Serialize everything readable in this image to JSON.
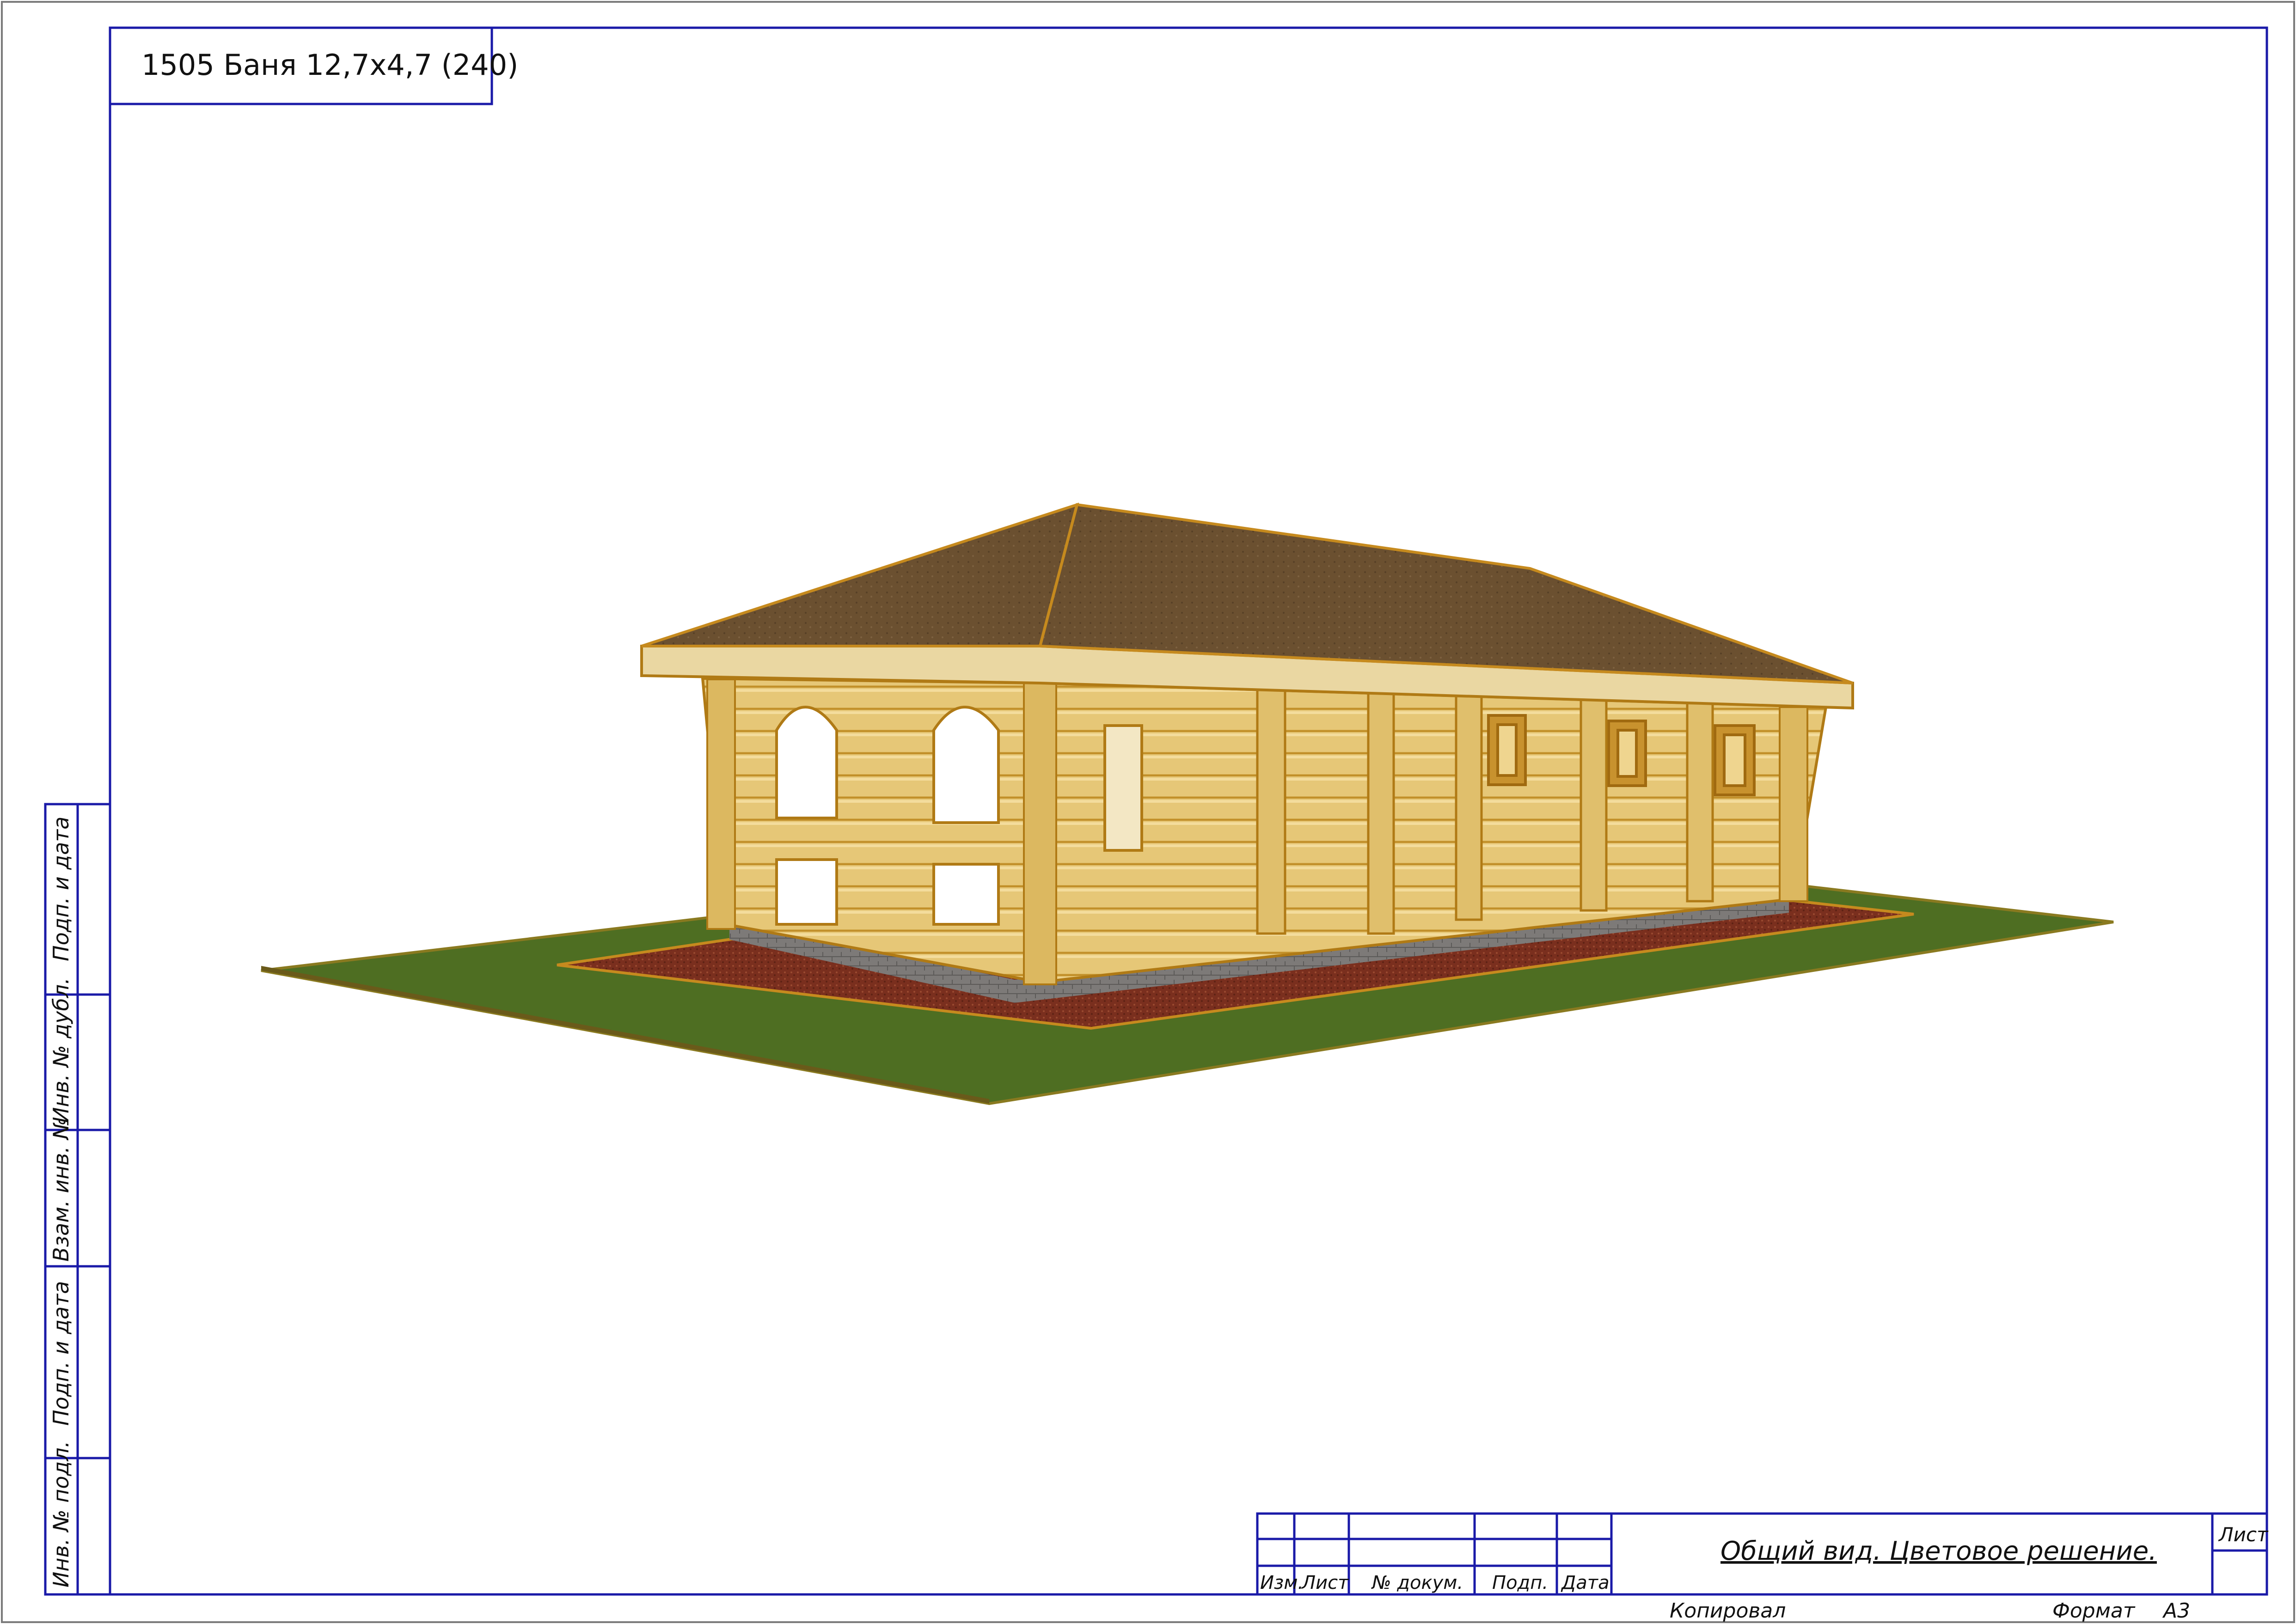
{
  "drawing": {
    "project_label": "1505 Баня 12,7х4,7 (240)",
    "sheet_title": "Общий вид. Цветовое решение.",
    "sheet_label": "Лист",
    "copied_label": "Копировал",
    "format_label": "Формат",
    "format_value": "А3"
  },
  "side_stamp": [
    "Подп. и дата",
    "Инв. № дубл.",
    "Взам. инв. №",
    "Подп. и дата",
    "Инв. № подл."
  ],
  "title_block_headers": [
    "Изм.",
    "Лист",
    "№ докум.",
    "Подп.",
    "Дата"
  ],
  "colors": {
    "frame_line": "#1a1aa8",
    "outer_border": "#7a7a7a",
    "roof": "#6b5030",
    "log_wall": "#e6c777",
    "log_outline": "#b07a15",
    "grass": "#4e6e22",
    "gravel": "#7a2f1e",
    "plinth": "#7d7a78"
  }
}
